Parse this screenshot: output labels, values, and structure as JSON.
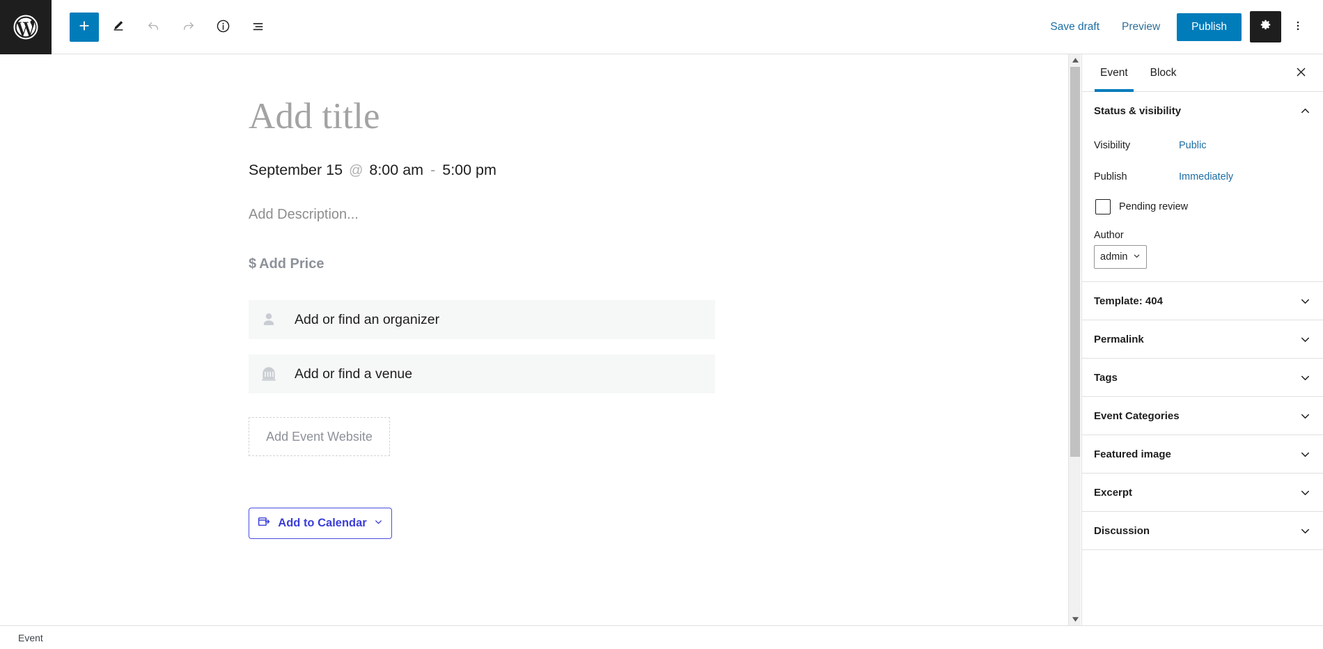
{
  "topbar": {
    "logo_icon": "wordpress-logo-icon",
    "tools": [
      {
        "name": "add-block-button",
        "icon": "plus-icon",
        "label": "",
        "style": "primary"
      },
      {
        "name": "tools-pencil-button",
        "icon": "pencil-icon",
        "label": "",
        "style": "plain"
      },
      {
        "name": "undo-button",
        "icon": "undo-arrow-icon",
        "label": "",
        "style": "disabled"
      },
      {
        "name": "redo-button",
        "icon": "redo-arrow-icon",
        "label": "",
        "style": "disabled"
      },
      {
        "name": "details-button",
        "icon": "info-circle-icon",
        "label": "",
        "style": "plain"
      },
      {
        "name": "list-view-button",
        "icon": "list-view-icon",
        "label": "",
        "style": "plain"
      }
    ],
    "save_draft_label": "Save draft",
    "preview_label": "Preview",
    "publish_label": "Publish",
    "settings_icon": "gear-icon",
    "options_icon": "kebab-menu-icon",
    "accent_color": "#007cba",
    "link_color": "#1d6ea3"
  },
  "editor": {
    "title_placeholder": "Add title",
    "date": "September 15",
    "at_symbol": "@",
    "start_time": "8:00 am",
    "time_separator": "-",
    "end_time": "5:00 pm",
    "description_placeholder": "Add Description...",
    "price_currency": "$",
    "price_placeholder": "Add Price",
    "organizer_placeholder": "Add or find an organizer",
    "venue_placeholder": "Add or find a venue",
    "website_placeholder": "Add Event Website",
    "calendar_button_label": "Add to Calendar",
    "calendar_button_color": "#3b3ed8"
  },
  "sidebar": {
    "tabs": [
      {
        "label": "Event",
        "active": true
      },
      {
        "label": "Block",
        "active": false
      }
    ],
    "close_icon": "close-x-icon",
    "status_panel": {
      "title": "Status & visibility",
      "expanded": true,
      "visibility_label": "Visibility",
      "visibility_value": "Public",
      "publish_label": "Publish",
      "publish_value": "Immediately",
      "pending_review_label": "Pending review",
      "pending_review_checked": false,
      "author_label": "Author",
      "author_value": "admin"
    },
    "panels": [
      {
        "label": "Template: 404"
      },
      {
        "label": "Permalink"
      },
      {
        "label": "Tags"
      },
      {
        "label": "Event Categories"
      },
      {
        "label": "Featured image"
      },
      {
        "label": "Excerpt"
      },
      {
        "label": "Discussion"
      }
    ]
  },
  "statusbar": {
    "breadcrumb": "Event"
  }
}
